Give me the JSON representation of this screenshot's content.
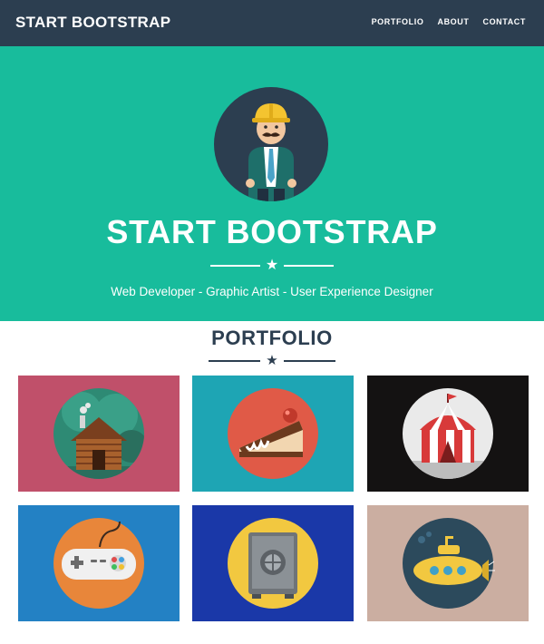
{
  "navbar": {
    "brand": "START BOOTSTRAP",
    "links": [
      "PORTFOLIO",
      "ABOUT",
      "CONTACT"
    ]
  },
  "hero": {
    "title": "START BOOTSTRAP",
    "subtitle": "Web Developer - Graphic Artist - User Experience Designer",
    "avatar_icon": "construction-worker-avatar"
  },
  "portfolio": {
    "title": "PORTFOLIO",
    "items": [
      {
        "icon": "log-cabin-icon",
        "background": "#c0506a"
      },
      {
        "icon": "cake-slice-icon",
        "background": "#1ea5b4"
      },
      {
        "icon": "circus-tent-icon",
        "background": "#141212"
      },
      {
        "icon": "game-controller-icon",
        "background": "#2381c4"
      },
      {
        "icon": "safe-icon",
        "background": "#1a38a8"
      },
      {
        "icon": "submarine-icon",
        "background": "#cbaea1"
      }
    ]
  },
  "colors": {
    "navbar": "#2c3e50",
    "hero": "#18bc9c",
    "text_dark": "#2c3e50"
  }
}
